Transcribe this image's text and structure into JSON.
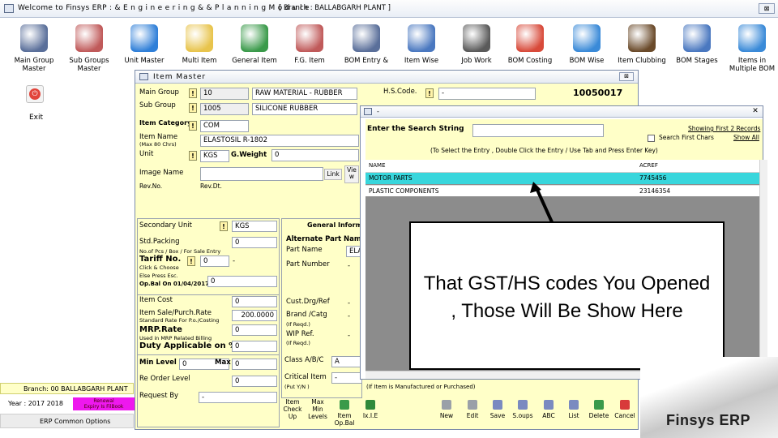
{
  "window": {
    "title": "Welcome to Finsys ERP : & E n g i n e e r i n g  & &  P l a n n i n g  M o d u l e",
    "branch": "[ Branch : BALLABGARH PLANT ]",
    "close_label": "⊠"
  },
  "toolbar": [
    {
      "label": "Main Group\nMaster",
      "icon": "speaker-icon",
      "color": "#5a6f9a"
    },
    {
      "label": "Sub Groups\nMaster",
      "icon": "database-icon",
      "color": "#c05a5a"
    },
    {
      "label": "Unit Master",
      "icon": "ie-icon",
      "color": "#2f7fd8"
    },
    {
      "label": "Multi Item",
      "icon": "folder-icon",
      "color": "#e8c44c"
    },
    {
      "label": "General Item",
      "icon": "windows-logo-icon",
      "color": "#3a9a4a"
    },
    {
      "label": "F.G. Item",
      "icon": "database-icon",
      "color": "#c05a5a"
    },
    {
      "label": "BOM Entry &",
      "icon": "speaker-icon",
      "color": "#5a6f9a"
    },
    {
      "label": "Item Wise",
      "icon": "checklist-icon",
      "color": "#4a78c0"
    },
    {
      "label": "Job Work",
      "icon": "film-reel-icon",
      "color": "#5a5a5a"
    },
    {
      "label": "BOM Costing",
      "icon": "butterfly-icon",
      "color": "#d84a3a"
    },
    {
      "label": "BOM Wise",
      "icon": "globe-window-icon",
      "color": "#3a8ad8"
    },
    {
      "label": "Item Clubbing",
      "icon": "magnifier-user-icon",
      "color": "#6a4a2a"
    },
    {
      "label": "BOM Stages",
      "icon": "checklist-icon",
      "color": "#4a78c0"
    },
    {
      "label": "Items in\nMultiple BOM",
      "icon": "monitor-icon",
      "color": "#3a8ad8"
    }
  ],
  "exit_label": "Exit",
  "status": {
    "branch": "Branch: 00 BALLABGARH PLANT",
    "year": "Year : 2017 2018",
    "alert": "Renewal\nExpiry Is FilBook",
    "erp_options": "ERP Common Options"
  },
  "item_master": {
    "title": "Item Master",
    "main_group_label": "Main Group",
    "main_group_code": "10",
    "main_group_name": "RAW MATERIAL - RUBBER",
    "hs_code_label": "H.S.Code.",
    "hs_code_value": "-",
    "item_code": "10050017",
    "sub_group_label": "Sub Group",
    "sub_group_code": "1005",
    "sub_group_name": "SILICONE RUBBER",
    "item_category_label": "Item Category",
    "item_category_value": "COM",
    "item_name_label": "Item Name",
    "item_name_hint": "(Max 80 Chrs)",
    "item_name_value": "ELASTOSIL R-1802",
    "unit_label": "Unit",
    "unit_value": "KGS",
    "g_weight_label": "G.Weight",
    "g_weight_value": "0",
    "image_name_label": "Image Name",
    "link_label": "Link",
    "view_label": "Vie\nw",
    "rev_no_label": "Rev.No.",
    "rev_dt_label": "Rev.Dt.",
    "secondary_unit_label": "Secondary Unit",
    "secondary_unit_value": "KGS",
    "std_packing_label": "Std.Packing",
    "std_packing_value": "0",
    "std_packing_hint": "No.of Pcs / Box / For Sale Entry",
    "tariff_no_label": "Tariff No.",
    "tariff_no_value": "0",
    "tariff_dash": "-",
    "tariff_hint1": "Click & Choose",
    "tariff_hint2": "Else Press Esc.",
    "op_bal_label": "Op.Bal On 01/04/2017",
    "op_bal_value": "0",
    "item_cost_label": "Item Cost",
    "item_cost_value": "0",
    "sale_purch_label": "Item Sale/Purch.Rate",
    "sale_purch_hint": "Standard Rate For P.o./Costing",
    "sale_purch_value": "200.0000",
    "mrp_label": "MRP.Rate",
    "mrp_hint": "Used in MRP Related Billing",
    "mrp_value": "0",
    "duty_label": "Duty Applicable on %",
    "duty_value": "0",
    "min_level_label": "Min Level",
    "min_level_value": "0",
    "max_label": "Max",
    "max_value": "0",
    "reorder_label": "Re Order Level",
    "reorder_value": "0",
    "request_by_label": "Request By",
    "request_by_value": "-",
    "general_info_tab": "General Inform",
    "alt_part_label": "Alternate Part Name",
    "part_name_label": "Part Name",
    "part_name_value": "ELA",
    "part_number_label": "Part Number",
    "cust_drg_label": "Cust.Drg/Ref",
    "brand_label": "Brand /Catg",
    "wip_ref_label": "WIP Ref.",
    "if_reqd": "(If Reqd.)",
    "dash": "-",
    "class_label": "Class A/B/C",
    "class_value": "A",
    "critical_item_label": "Critical Item",
    "critical_item_hint": "(Put Y/N )",
    "critical_item_value": "-",
    "manufactured_note": "(If Item is Manufactured or Purchased)"
  },
  "bottom_buttons": [
    {
      "label": "Item\nCheck\nUp",
      "icon": "none",
      "color": "#ffffc8"
    },
    {
      "label": "Max\nMin\nLevels",
      "icon": "none",
      "color": "#ffffc8"
    },
    {
      "label": "Item\nOp.Bal",
      "icon": "windows-logo-icon",
      "color": "#3a9a4a"
    },
    {
      "label": "Ix.I.E",
      "icon": "excel-icon",
      "color": "#2f8a3a"
    },
    {
      "label": "New",
      "icon": "new-file-icon",
      "color": "#9aa0a8"
    },
    {
      "label": "Edit",
      "icon": "edit-icon",
      "color": "#9aa0a8"
    },
    {
      "label": "Save",
      "icon": "save-icon",
      "color": "#7a8ac0"
    },
    {
      "label": "S.oups",
      "icon": "document-icon",
      "color": "#7a8ac0"
    },
    {
      "label": "ABC",
      "icon": "document-icon",
      "color": "#7a8ac0"
    },
    {
      "label": "List",
      "icon": "list-icon",
      "color": "#7a8ac0"
    },
    {
      "label": "Delete",
      "icon": "windows-logo-icon",
      "color": "#3a9a4a"
    },
    {
      "label": "Cancel",
      "icon": "cancel-icon",
      "color": "#d83a3a"
    }
  ],
  "search": {
    "title": "-",
    "prompt": "Enter the Search String",
    "show_first_records": "Showing First 2 Records",
    "search_first_chars": "Search First Chars",
    "show_all": "Show All",
    "instruction": "(To Select the Entry , Double Click the Entry / Use Tab and Press Enter Key)",
    "columns": [
      "NAME",
      "ACREF"
    ],
    "rows": [
      {
        "name": "MOTOR PARTS",
        "acref": "7745456"
      },
      {
        "name": "PLASTIC COMPONENTS",
        "acref": "23146354"
      }
    ],
    "selected_row_color": "#38d6dc"
  },
  "callout": {
    "text": "That GST/HS codes You Opened\n, Those Will Be Show Here"
  },
  "brand": "Finsys ERP"
}
